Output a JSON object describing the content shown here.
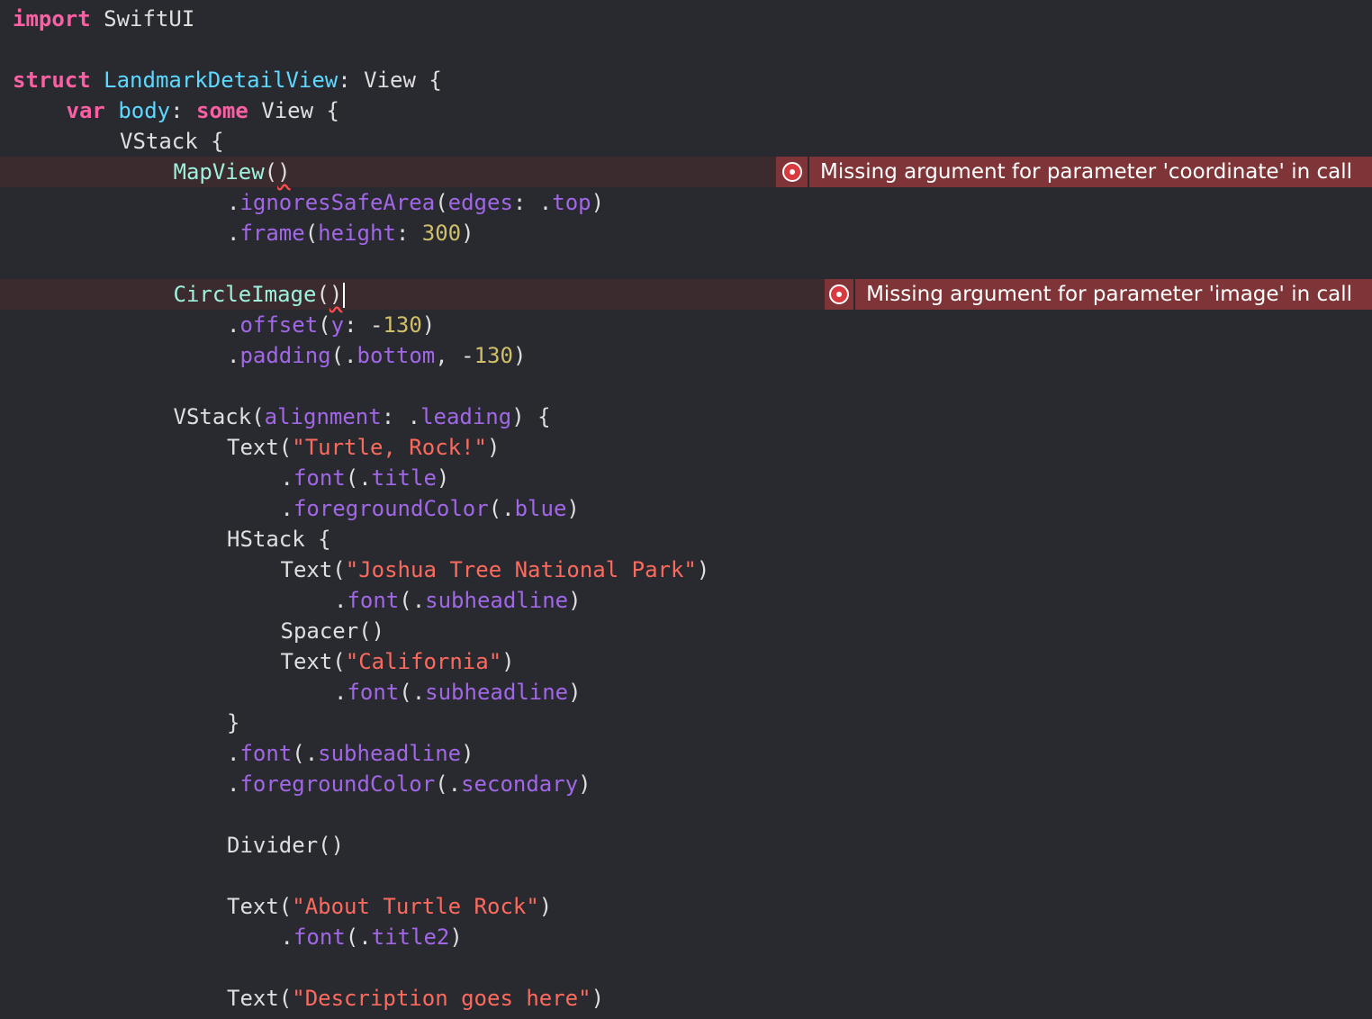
{
  "editor": {
    "language": "Swift",
    "colors": {
      "background": "#292a30",
      "error_line": "#3b2b2f",
      "error_badge": "#7f3537",
      "keyword": "#fc5fa3",
      "string": "#fc6a5d",
      "number": "#d0bf69"
    },
    "lines": [
      {
        "indent": 0,
        "tokens": [
          {
            "t": "import",
            "c": "kw"
          },
          {
            "t": " SwiftUI",
            "c": "pl"
          }
        ]
      },
      {
        "indent": 0,
        "tokens": []
      },
      {
        "indent": 0,
        "tokens": [
          {
            "t": "struct",
            "c": "kw"
          },
          {
            "t": " ",
            "c": "pl"
          },
          {
            "t": "LandmarkDetailView",
            "c": "type"
          },
          {
            "t": ": View {",
            "c": "pl"
          }
        ]
      },
      {
        "indent": 1,
        "tokens": [
          {
            "t": "var",
            "c": "kw"
          },
          {
            "t": " ",
            "c": "pl"
          },
          {
            "t": "body",
            "c": "type"
          },
          {
            "t": ": ",
            "c": "pl"
          },
          {
            "t": "some",
            "c": "kw"
          },
          {
            "t": " View {",
            "c": "pl"
          }
        ]
      },
      {
        "indent": 2,
        "tokens": [
          {
            "t": "VStack {",
            "c": "pl"
          }
        ]
      },
      {
        "indent": 3,
        "error": true,
        "tokens": [
          {
            "t": "MapView",
            "c": "prj"
          },
          {
            "t": "(",
            "c": "pl"
          },
          {
            "t": ")",
            "c": "pl",
            "squiggle": true
          }
        ],
        "error_message": "Missing argument for parameter 'coordinate' in call",
        "error_icon": "error-circle-icon"
      },
      {
        "indent": 4,
        "tokens": [
          {
            "t": ".",
            "c": "pl"
          },
          {
            "t": "ignoresSafeArea",
            "c": "api"
          },
          {
            "t": "(",
            "c": "pl"
          },
          {
            "t": "edges",
            "c": "api"
          },
          {
            "t": ": .",
            "c": "pl"
          },
          {
            "t": "top",
            "c": "api"
          },
          {
            "t": ")",
            "c": "pl"
          }
        ]
      },
      {
        "indent": 4,
        "tokens": [
          {
            "t": ".",
            "c": "pl"
          },
          {
            "t": "frame",
            "c": "api"
          },
          {
            "t": "(",
            "c": "pl"
          },
          {
            "t": "height",
            "c": "api"
          },
          {
            "t": ": ",
            "c": "pl"
          },
          {
            "t": "300",
            "c": "num"
          },
          {
            "t": ")",
            "c": "pl"
          }
        ]
      },
      {
        "indent": 0,
        "tokens": []
      },
      {
        "indent": 3,
        "error": true,
        "caret": true,
        "tokens": [
          {
            "t": "CircleImage",
            "c": "prj"
          },
          {
            "t": "(",
            "c": "pl"
          },
          {
            "t": ")",
            "c": "pl",
            "squiggle": true
          }
        ],
        "error_message": "Missing argument for parameter 'image' in call",
        "error_icon": "error-circle-icon"
      },
      {
        "indent": 4,
        "tokens": [
          {
            "t": ".",
            "c": "pl"
          },
          {
            "t": "offset",
            "c": "api"
          },
          {
            "t": "(",
            "c": "pl"
          },
          {
            "t": "y",
            "c": "api"
          },
          {
            "t": ": -",
            "c": "pl"
          },
          {
            "t": "130",
            "c": "num"
          },
          {
            "t": ")",
            "c": "pl"
          }
        ]
      },
      {
        "indent": 4,
        "tokens": [
          {
            "t": ".",
            "c": "pl"
          },
          {
            "t": "padding",
            "c": "api"
          },
          {
            "t": "(.",
            "c": "pl"
          },
          {
            "t": "bottom",
            "c": "api"
          },
          {
            "t": ", -",
            "c": "pl"
          },
          {
            "t": "130",
            "c": "num"
          },
          {
            "t": ")",
            "c": "pl"
          }
        ]
      },
      {
        "indent": 0,
        "tokens": []
      },
      {
        "indent": 3,
        "tokens": [
          {
            "t": "VStack",
            "c": "pl"
          },
          {
            "t": "(",
            "c": "pl"
          },
          {
            "t": "alignment",
            "c": "api"
          },
          {
            "t": ": .",
            "c": "pl"
          },
          {
            "t": "leading",
            "c": "api"
          },
          {
            "t": ") {",
            "c": "pl"
          }
        ]
      },
      {
        "indent": 4,
        "tokens": [
          {
            "t": "Text",
            "c": "pl"
          },
          {
            "t": "(",
            "c": "pl"
          },
          {
            "t": "\"Turtle, Rock!\"",
            "c": "str"
          },
          {
            "t": ")",
            "c": "pl"
          }
        ]
      },
      {
        "indent": 5,
        "tokens": [
          {
            "t": ".",
            "c": "pl"
          },
          {
            "t": "font",
            "c": "api"
          },
          {
            "t": "(.",
            "c": "pl"
          },
          {
            "t": "title",
            "c": "api"
          },
          {
            "t": ")",
            "c": "pl"
          }
        ]
      },
      {
        "indent": 5,
        "tokens": [
          {
            "t": ".",
            "c": "pl"
          },
          {
            "t": "foregroundColor",
            "c": "api"
          },
          {
            "t": "(.",
            "c": "pl"
          },
          {
            "t": "blue",
            "c": "api"
          },
          {
            "t": ")",
            "c": "pl"
          }
        ]
      },
      {
        "indent": 4,
        "tokens": [
          {
            "t": "HStack {",
            "c": "pl"
          }
        ]
      },
      {
        "indent": 5,
        "tokens": [
          {
            "t": "Text",
            "c": "pl"
          },
          {
            "t": "(",
            "c": "pl"
          },
          {
            "t": "\"Joshua Tree National Park\"",
            "c": "str"
          },
          {
            "t": ")",
            "c": "pl"
          }
        ]
      },
      {
        "indent": 6,
        "tokens": [
          {
            "t": ".",
            "c": "pl"
          },
          {
            "t": "font",
            "c": "api"
          },
          {
            "t": "(.",
            "c": "pl"
          },
          {
            "t": "subheadline",
            "c": "api"
          },
          {
            "t": ")",
            "c": "pl"
          }
        ]
      },
      {
        "indent": 5,
        "tokens": [
          {
            "t": "Spacer()",
            "c": "pl"
          }
        ]
      },
      {
        "indent": 5,
        "tokens": [
          {
            "t": "Text",
            "c": "pl"
          },
          {
            "t": "(",
            "c": "pl"
          },
          {
            "t": "\"California\"",
            "c": "str"
          },
          {
            "t": ")",
            "c": "pl"
          }
        ]
      },
      {
        "indent": 6,
        "tokens": [
          {
            "t": ".",
            "c": "pl"
          },
          {
            "t": "font",
            "c": "api"
          },
          {
            "t": "(.",
            "c": "pl"
          },
          {
            "t": "subheadline",
            "c": "api"
          },
          {
            "t": ")",
            "c": "pl"
          }
        ]
      },
      {
        "indent": 4,
        "tokens": [
          {
            "t": "}",
            "c": "pl"
          }
        ]
      },
      {
        "indent": 4,
        "tokens": [
          {
            "t": ".",
            "c": "pl"
          },
          {
            "t": "font",
            "c": "api"
          },
          {
            "t": "(.",
            "c": "pl"
          },
          {
            "t": "subheadline",
            "c": "api"
          },
          {
            "t": ")",
            "c": "pl"
          }
        ]
      },
      {
        "indent": 4,
        "tokens": [
          {
            "t": ".",
            "c": "pl"
          },
          {
            "t": "foregroundColor",
            "c": "api"
          },
          {
            "t": "(.",
            "c": "pl"
          },
          {
            "t": "secondary",
            "c": "api"
          },
          {
            "t": ")",
            "c": "pl"
          }
        ]
      },
      {
        "indent": 0,
        "tokens": []
      },
      {
        "indent": 4,
        "tokens": [
          {
            "t": "Divider()",
            "c": "pl"
          }
        ]
      },
      {
        "indent": 0,
        "tokens": []
      },
      {
        "indent": 4,
        "tokens": [
          {
            "t": "Text",
            "c": "pl"
          },
          {
            "t": "(",
            "c": "pl"
          },
          {
            "t": "\"About Turtle Rock\"",
            "c": "str"
          },
          {
            "t": ")",
            "c": "pl"
          }
        ]
      },
      {
        "indent": 5,
        "tokens": [
          {
            "t": ".",
            "c": "pl"
          },
          {
            "t": "font",
            "c": "api"
          },
          {
            "t": "(.",
            "c": "pl"
          },
          {
            "t": "title2",
            "c": "api"
          },
          {
            "t": ")",
            "c": "pl"
          }
        ]
      },
      {
        "indent": 0,
        "tokens": []
      },
      {
        "indent": 4,
        "tokens": [
          {
            "t": "Text",
            "c": "pl"
          },
          {
            "t": "(",
            "c": "pl"
          },
          {
            "t": "\"Description goes here\"",
            "c": "str"
          },
          {
            "t": ")",
            "c": "pl"
          }
        ]
      }
    ]
  }
}
